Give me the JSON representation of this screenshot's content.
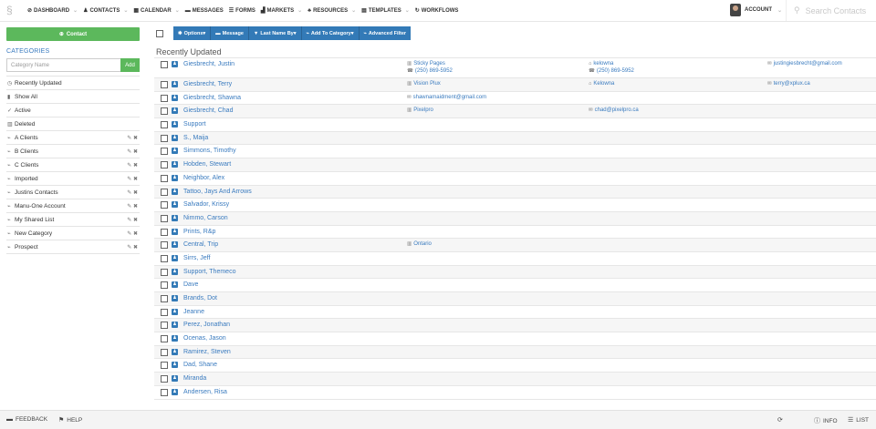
{
  "nav": {
    "items": [
      {
        "icon": "⊘",
        "label": "DASHBOARD"
      },
      {
        "icon": "♟",
        "label": "CONTACTS"
      },
      {
        "icon": "▦",
        "label": "CALENDAR"
      },
      {
        "icon": "▬",
        "label": "MESSAGES"
      },
      {
        "icon": "☰",
        "label": "FORMS"
      },
      {
        "icon": "▟",
        "label": "MARKETS"
      },
      {
        "icon": "♣",
        "label": "RESOURCES"
      },
      {
        "icon": "▤",
        "label": "TEMPLATES"
      },
      {
        "icon": "↻",
        "label": "WORKFLOWS"
      }
    ],
    "account_label": "ACCOUNT",
    "search_placeholder": "Search Contacts"
  },
  "sidebar": {
    "contact_button": "Contact",
    "categories_title": "CATEGORIES",
    "category_placeholder": "Category Name",
    "add_button": "Add",
    "items": [
      {
        "icon": "◷",
        "label": "Recently Updated",
        "editable": false
      },
      {
        "icon": "▮",
        "label": "Show All",
        "editable": false
      },
      {
        "icon": "✓",
        "label": "Active",
        "editable": false
      },
      {
        "icon": "▥",
        "label": "Deleted",
        "editable": false
      },
      {
        "icon": "⌁",
        "label": "A Clients",
        "editable": true
      },
      {
        "icon": "⌁",
        "label": "B Clients",
        "editable": true
      },
      {
        "icon": "⌁",
        "label": "C Clients",
        "editable": true
      },
      {
        "icon": "⌁",
        "label": "Imported",
        "editable": true
      },
      {
        "icon": "⌁",
        "label": "Justins Contacts",
        "editable": true
      },
      {
        "icon": "⌁",
        "label": "Manu-One Account",
        "editable": true
      },
      {
        "icon": "⌁",
        "label": "My Shared List",
        "editable": true
      },
      {
        "icon": "⌁",
        "label": "New Category",
        "editable": true
      },
      {
        "icon": "⌁",
        "label": "Prospect",
        "editable": true
      }
    ]
  },
  "toolbar": {
    "buttons": [
      {
        "icon": "✱",
        "label": "Options"
      },
      {
        "icon": "▬",
        "label": "Message"
      },
      {
        "icon": "▼",
        "label": "Last Name By"
      },
      {
        "icon": "⌁",
        "label": "Add To Category"
      },
      {
        "icon": "⌁",
        "label": "Advanced Filter"
      }
    ]
  },
  "list": {
    "title": "Recently Updated",
    "rows": [
      {
        "name": "Giesbrecht, Justin",
        "c1": [
          "Sticky Pages",
          "(250) 869-5952"
        ],
        "c2": [
          "kelowna",
          "(250) 869-5952"
        ],
        "c3": [
          "justingiesbrecht@gmail.com"
        ]
      },
      {
        "name": "Giesbrecht, Terry",
        "c1": [
          "Vision Plux"
        ],
        "c2": [
          "Kelowna"
        ],
        "c3": [
          "terry@xplux.ca"
        ]
      },
      {
        "name": "Giesbrecht, Shawna",
        "c1": [
          "shawnamaidment@gmail.com"
        ],
        "c2": [],
        "c3": []
      },
      {
        "name": "Giesbrecht, Chad",
        "c1": [
          "Pixelpro"
        ],
        "c2": [
          "chad@pixelpro.ca"
        ],
        "c3": []
      },
      {
        "name": "Support",
        "c1": [],
        "c2": [],
        "c3": []
      },
      {
        "name": "S., Maija",
        "c1": [],
        "c2": [],
        "c3": []
      },
      {
        "name": "Simmons, Timothy",
        "c1": [],
        "c2": [],
        "c3": []
      },
      {
        "name": "Hobden, Stewart",
        "c1": [],
        "c2": [],
        "c3": []
      },
      {
        "name": "Neighbor, Alex",
        "c1": [],
        "c2": [],
        "c3": []
      },
      {
        "name": "Tattoo, Jays And Arrows",
        "c1": [],
        "c2": [],
        "c3": []
      },
      {
        "name": "Salvador, Krissy",
        "c1": [],
        "c2": [],
        "c3": []
      },
      {
        "name": "Nimmo, Carson",
        "c1": [],
        "c2": [],
        "c3": []
      },
      {
        "name": "Prints, R&p",
        "c1": [],
        "c2": [],
        "c3": []
      },
      {
        "name": "Central, Trip",
        "c1": [
          "Ontario"
        ],
        "c2": [],
        "c3": []
      },
      {
        "name": "Sirrs, Jeff",
        "c1": [],
        "c2": [],
        "c3": []
      },
      {
        "name": "Support, Themeco",
        "c1": [],
        "c2": [],
        "c3": []
      },
      {
        "name": "Dave",
        "c1": [],
        "c2": [],
        "c3": []
      },
      {
        "name": "Brands, Dot",
        "c1": [],
        "c2": [],
        "c3": []
      },
      {
        "name": "Jeanne",
        "c1": [],
        "c2": [],
        "c3": []
      },
      {
        "name": "Perez, Jonathan",
        "c1": [],
        "c2": [],
        "c3": []
      },
      {
        "name": "Ocenas, Jason",
        "c1": [],
        "c2": [],
        "c3": []
      },
      {
        "name": "Ramirez, Steven",
        "c1": [],
        "c2": [],
        "c3": []
      },
      {
        "name": "Dad, Shane",
        "c1": [],
        "c2": [],
        "c3": []
      },
      {
        "name": "Miranda",
        "c1": [],
        "c2": [],
        "c3": []
      },
      {
        "name": "Andersen, Risa",
        "c1": [],
        "c2": [],
        "c3": []
      }
    ]
  },
  "footer": {
    "feedback": "FEEDBACK",
    "help": "HELP",
    "info": "INFO",
    "list": "LIST"
  }
}
